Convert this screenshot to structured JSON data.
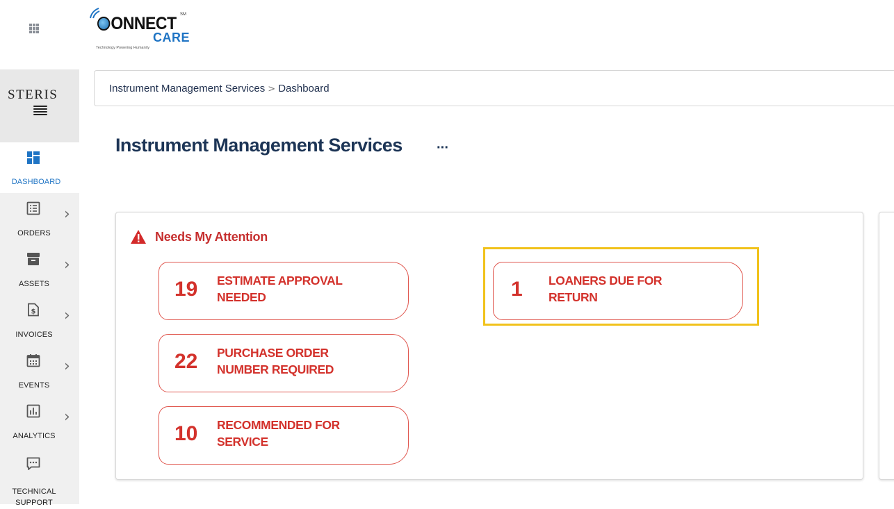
{
  "app": {
    "logo_word1": "ONNECT",
    "logo_word2": "CARE",
    "logo_sm": "SM",
    "logo_tagline": "Technology Powering Humanity",
    "company": "STERIS"
  },
  "sidebar": {
    "items": [
      {
        "label": "DASHBOARD",
        "icon": "dashboard-icon"
      },
      {
        "label": "ORDERS",
        "icon": "orders-icon"
      },
      {
        "label": "ASSETS",
        "icon": "archive-icon"
      },
      {
        "label": "INVOICES",
        "icon": "invoice-icon"
      },
      {
        "label": "EVENTS",
        "icon": "calendar-icon"
      },
      {
        "label": "ANALYTICS",
        "icon": "analytics-icon"
      },
      {
        "label": "TECHNICAL SUPPORT",
        "icon": "chat-icon"
      }
    ]
  },
  "breadcrumb": {
    "root": "Instrument Management Services",
    "separator": ">",
    "current": "Dashboard"
  },
  "page": {
    "title": "Instrument Management Services",
    "more": "···"
  },
  "attention": {
    "title": "Needs My Attention",
    "tiles": [
      {
        "count": "19",
        "line1": "ESTIMATE APPROVAL",
        "line2": "NEEDED"
      },
      {
        "count": "22",
        "line1": "PURCHASE ORDER",
        "line2": "NUMBER REQUIRED"
      },
      {
        "count": "10",
        "line1": "RECOMMENDED FOR",
        "line2": "SERVICE"
      },
      {
        "count": "1",
        "line1": "LOANERS DUE FOR",
        "line2": "RETURN"
      }
    ]
  },
  "colors": {
    "accent_red": "#d3322c",
    "brand_blue": "#1f74c4",
    "title_navy": "#1d3556",
    "highlight": "#f1c21b"
  }
}
